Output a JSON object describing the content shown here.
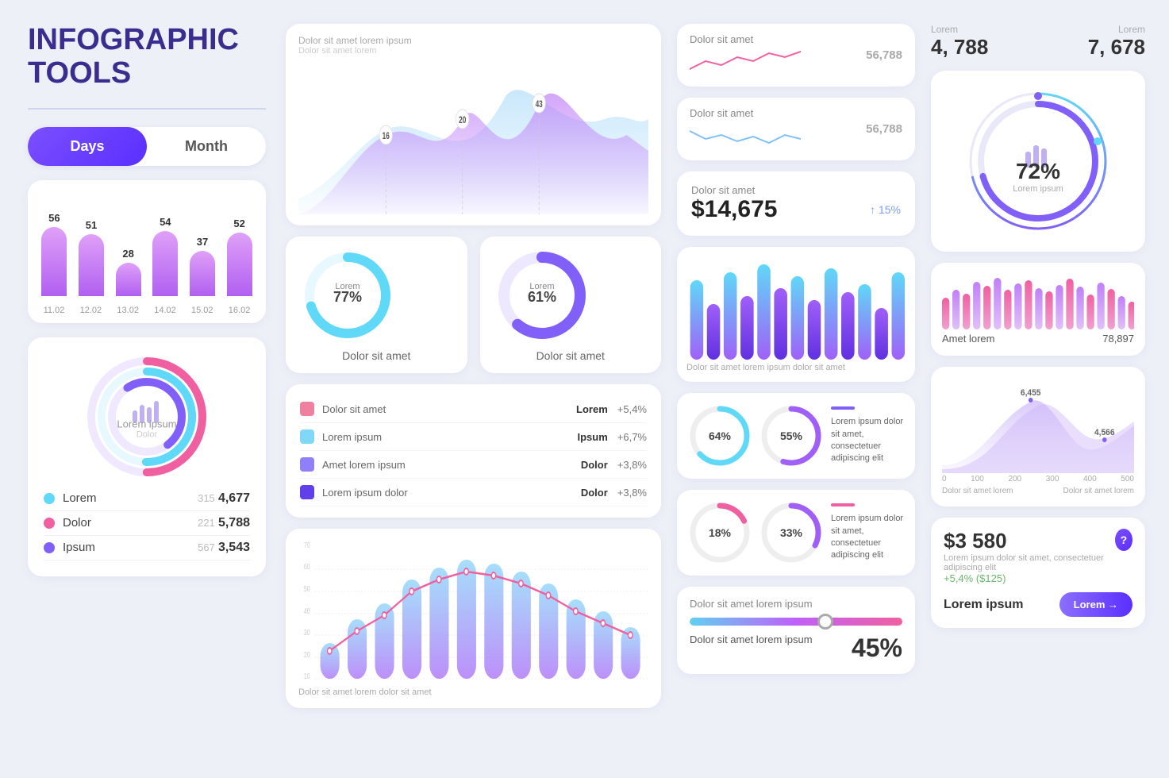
{
  "title": "INFOGRAPHIC TOOLS",
  "toggle": {
    "days_label": "Days",
    "month_label": "Month"
  },
  "bar_chart": {
    "bars": [
      {
        "top_label": "56",
        "height_pct": 72,
        "date": "11.02",
        "color_start": "#e0a0f8",
        "color_end": "#b060f0"
      },
      {
        "top_label": "51",
        "height_pct": 65,
        "date": "12.02",
        "color_start": "#e0a0f8",
        "color_end": "#b060f0"
      },
      {
        "top_label": "28",
        "height_pct": 35,
        "date": "13.02",
        "color_start": "#e0a0f8",
        "color_end": "#b060f0"
      },
      {
        "top_label": "54",
        "height_pct": 68,
        "date": "14.02",
        "color_start": "#e0a0f8",
        "color_end": "#b060f0"
      },
      {
        "top_label": "37",
        "height_pct": 47,
        "date": "15.02",
        "color_start": "#e0a0f8",
        "color_end": "#b060f0"
      },
      {
        "top_label": "52",
        "height_pct": 66,
        "date": "16.02",
        "color_start": "#e0a0f8",
        "color_end": "#b060f0"
      }
    ]
  },
  "donut_main": {
    "center_title": "Lorem ipsum",
    "center_sub": "Dolor",
    "legend": [
      {
        "label": "Lorem",
        "color": "#60d8f8",
        "mid": "315",
        "val": "4,677"
      },
      {
        "label": "Dolor",
        "color": "#f060a0",
        "mid": "221",
        "val": "5,788"
      },
      {
        "label": "Ipsum",
        "color": "#8060f8",
        "mid": "567",
        "val": "3,543"
      }
    ]
  },
  "area_chart": {
    "label_top": "Dolor sit amet lorem ipsum",
    "label_sub": "Dolor sit amet lorem",
    "peak1": "16",
    "peak2": "20",
    "peak3": "43"
  },
  "donut_cards": [
    {
      "label": "Lorem",
      "percent": "77%",
      "sub": "Dolor sit amet"
    },
    {
      "label": "Lorem",
      "percent": "61%",
      "sub": "Dolor sit amet"
    }
  ],
  "legend_table": {
    "rows": [
      {
        "color": "#f080a0",
        "label": "Dolor sit amet",
        "bold": "Lorem",
        "percent": "+5,4%"
      },
      {
        "color": "#80d8f8",
        "label": "Lorem ipsum",
        "bold": "Ipsum",
        "percent": "+6,7%"
      },
      {
        "color": "#9080f8",
        "label": "Amet lorem ipsum",
        "bold": "Dolor",
        "percent": "+3,8%"
      },
      {
        "color": "#6040e8",
        "label": "Lorem ipsum dolor",
        "bold": "Dolor",
        "percent": "+3,8%"
      }
    ]
  },
  "bar_line_chart": {
    "y_labels": [
      "10",
      "20",
      "30",
      "40",
      "50",
      "60",
      "70"
    ],
    "footer": "Dolor sit amet lorem dolor sit amet"
  },
  "line_cards": [
    {
      "label": "Dolor sit amet",
      "value": "56,788"
    },
    {
      "label": "Dolor sit amet",
      "value": "56,788"
    }
  ],
  "big_stat": {
    "label": "Dolor sit amet",
    "value": "$14,675",
    "change": "↑ 15%"
  },
  "vertical_bars": {
    "footer_text": "Dolor sit amet lorem ipsum dolor sit amet"
  },
  "circles_section": {
    "items": [
      {
        "percent": "64%",
        "color1": "#60d8f8",
        "color2": "#a060f8"
      },
      {
        "percent": "55%",
        "color1": "#a060f8",
        "color2": "#6040f8"
      },
      {
        "desc": "Lorem ipsum dolor sit amet, consectetuer adipiscing elit"
      }
    ],
    "items2": [
      {
        "percent": "18%",
        "color1": "#f060a0",
        "color2": "#f09030"
      },
      {
        "percent": "33%",
        "color1": "#a060f8",
        "color2": "#6040f8"
      },
      {
        "desc": "Lorem ipsum dolor sit amet, consectetuer adipiscing elit"
      }
    ]
  },
  "slider_section": {
    "label": "Dolor sit amet lorem ipsum",
    "sub": "Dolor sit amet lorem ipsum",
    "percent": "45%"
  },
  "col4": {
    "stat1_label": "Lorem",
    "stat1_value": "4, 788",
    "stat2_label": "Lorem",
    "stat2_value": "7, 678",
    "radial_percent": "72%",
    "radial_sub": "Lorem ipsum",
    "mini_bar_label": "Amet lorem",
    "mini_bar_value": "78,897",
    "area2": {
      "val1": "6,455",
      "val2": "4,566",
      "x_labels": [
        "0",
        "100",
        "200",
        "300",
        "400",
        "500"
      ],
      "footer_left": "Dolor sit amet lorem",
      "footer_right": "Dolor sit amet lorem"
    },
    "money": {
      "value": "$3 580",
      "desc": "Lorem ipsum dolor sit amet, consectetuer adipiscing elit",
      "change": "+5,4% ($125)",
      "lorem_label": "Lorem ipsum",
      "btn_label": "Lorem →"
    }
  }
}
